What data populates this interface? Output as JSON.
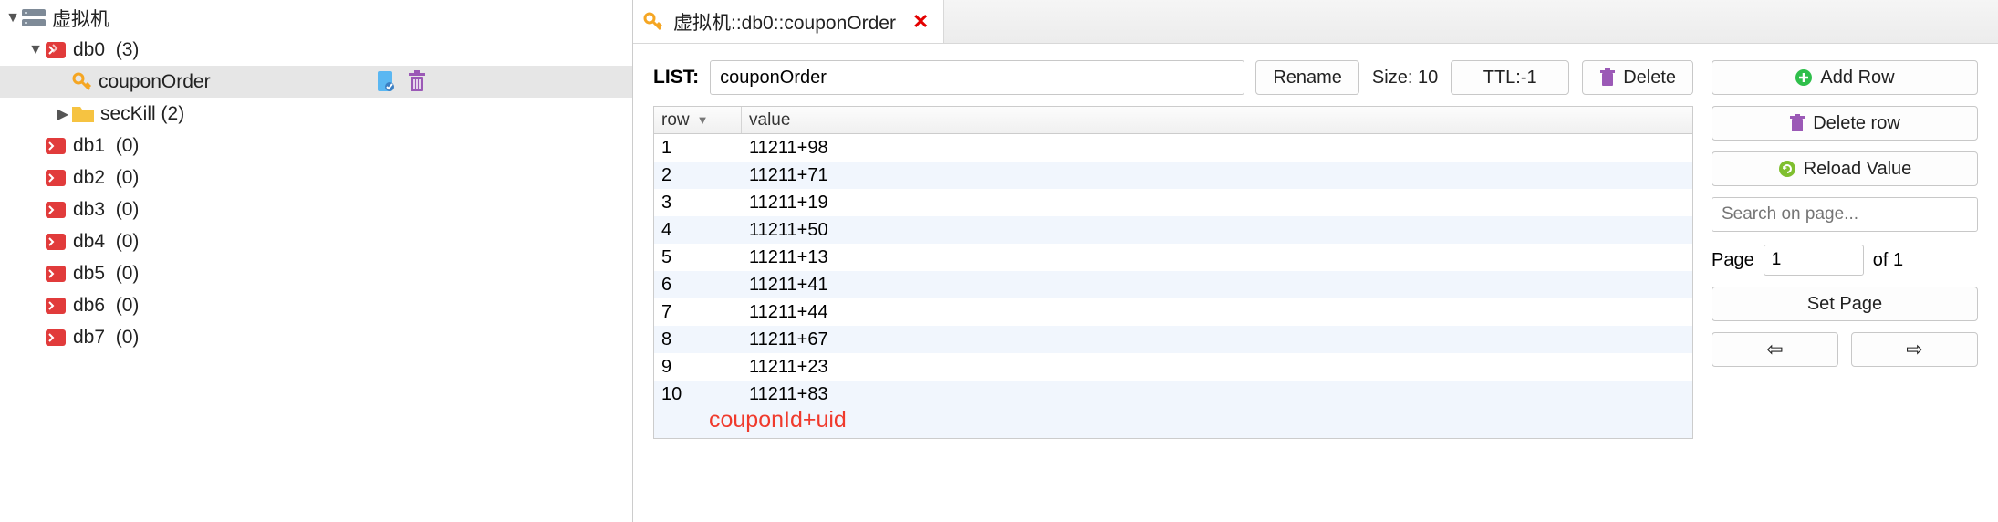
{
  "tree": {
    "root": {
      "label": "虚拟机"
    },
    "db0": {
      "label": "db0",
      "count": "(3)"
    },
    "couponOrder": {
      "label": "couponOrder"
    },
    "secKill": {
      "label": "secKill",
      "count": "(2)"
    },
    "db1": {
      "label": "db1",
      "count": "(0)"
    },
    "db2": {
      "label": "db2",
      "count": "(0)"
    },
    "db3": {
      "label": "db3",
      "count": "(0)"
    },
    "db4": {
      "label": "db4",
      "count": "(0)"
    },
    "db5": {
      "label": "db5",
      "count": "(0)"
    },
    "db6": {
      "label": "db6",
      "count": "(0)"
    },
    "db7": {
      "label": "db7",
      "count": "(0)"
    }
  },
  "tab": {
    "title": "虚拟机::db0::couponOrder"
  },
  "key": {
    "type_label": "LIST:",
    "name": "couponOrder",
    "rename_btn": "Rename",
    "size_label": "Size: 10",
    "ttl_btn": "TTL:-1",
    "delete_btn": "Delete"
  },
  "table": {
    "header_row": "row",
    "header_value": "value",
    "rows": [
      {
        "n": "1",
        "v": "11211+98"
      },
      {
        "n": "2",
        "v": "11211+71"
      },
      {
        "n": "3",
        "v": "11211+19"
      },
      {
        "n": "4",
        "v": "11211+50"
      },
      {
        "n": "5",
        "v": "11211+13"
      },
      {
        "n": "6",
        "v": "11211+41"
      },
      {
        "n": "7",
        "v": "11211+44"
      },
      {
        "n": "8",
        "v": "11211+67"
      },
      {
        "n": "9",
        "v": "11211+23"
      },
      {
        "n": "10",
        "v": "11211+83"
      }
    ],
    "annotation": "couponId+uid"
  },
  "side": {
    "add_row": "Add Row",
    "delete_row": "Delete row",
    "reload": "Reload Value",
    "search_placeholder": "Search on page...",
    "page_label": "Page",
    "page_value": "1",
    "of_label": "of 1",
    "set_page": "Set Page"
  }
}
